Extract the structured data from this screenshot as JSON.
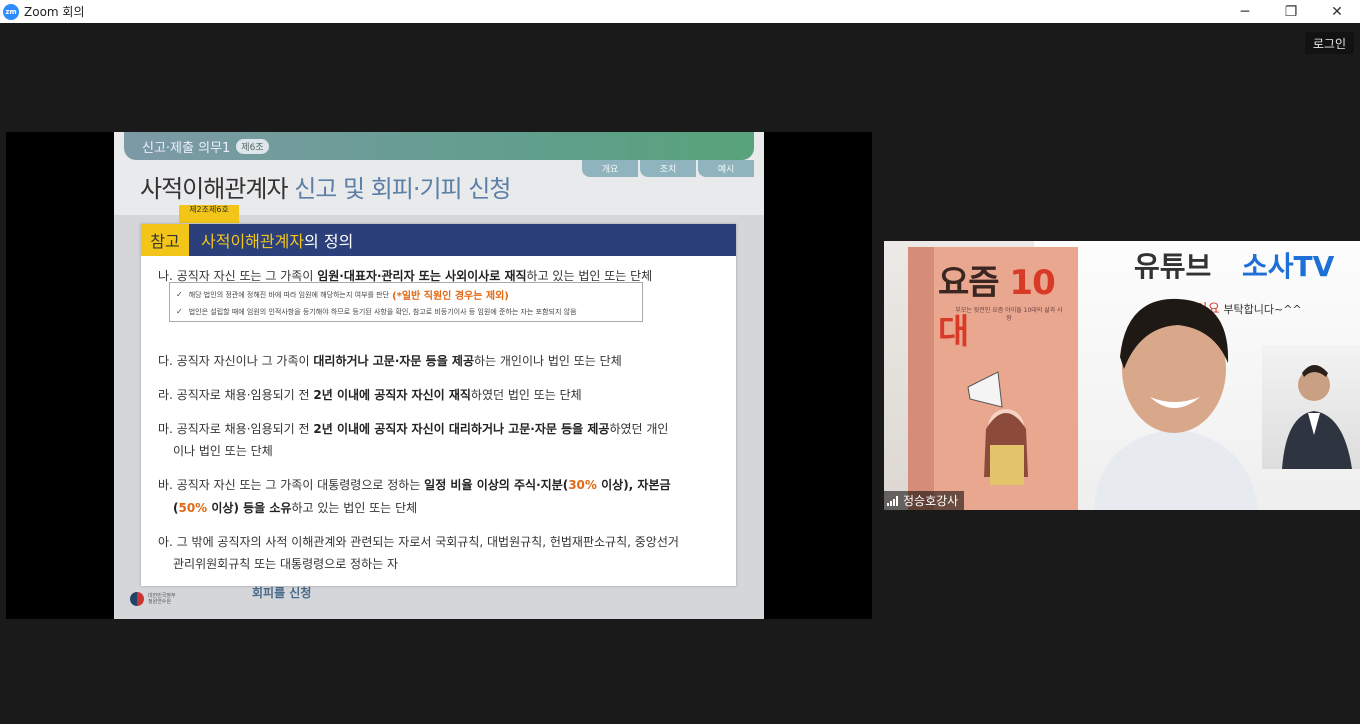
{
  "window": {
    "app_logo": "zm",
    "title": "Zoom 회의"
  },
  "controls": {
    "minimize": "─",
    "maximize": "❐",
    "close": "✕"
  },
  "toolbar": {
    "login_label": "로그인"
  },
  "slide": {
    "banner_label": "신고·제출 의무1",
    "banner_article": "제6조",
    "tabs": [
      "개요",
      "조치",
      "예시"
    ],
    "title_main": "사적이해관계자",
    "title_sub": " 신고 및 회피·기피 신청",
    "article_tag": "제2조제6호",
    "ref_badge": "참고",
    "ref_heading_highlight": "사적이해관계자",
    "ref_heading_rest": "의 정의",
    "na_pre": "나. 공직자 자신 또는 그 가족이 ",
    "na_bold": "임원·대표자·관리자 또는 사외이사로 재직",
    "na_post": "하고 있는 법인 또는 단체",
    "note1": "해당 법인의 정관에 정해진 바에 따라 임원에 해당하는지 여부를 판단",
    "note1_red": "(*일반 직원인 경우는 제외)",
    "note2": "법인은 설립할 때에 임원의 인적사항을 등기해야 하므로 등기된 사항을 확인, 참고로 비등기이사 등 임원에 준하는 자는 포함되지 않음",
    "check_mark": "✓",
    "da_pre": "다. 공직자 자신이나 그 가족이 ",
    "da_bold": "대리하거나 고문·자문 등을 제공",
    "da_post": "하는 개인이나 법인 또는 단체",
    "ra_pre": "라. 공직자로 채용·임용되기 전 ",
    "ra_bold": "2년 이내에 공직자 자신이 재직",
    "ra_post": "하였던 법인 또는 단체",
    "ma_pre": "마. 공직자로 채용·임용되기 전 ",
    "ma_bold": "2년 이내에 공직자 자신이 대리하거나 고문·자문 등을 제공",
    "ma_post": "하였던 개인",
    "ma_line2": "이나 법인 또는 단체",
    "ba_pre": "바. 공직자 자신 또는 그 가족이 대통령령으로 정하는 ",
    "ba_bold1": "일정 비율 이상의 주식·지분(",
    "ba_pct1": "30%",
    "ba_bold2": " 이상), 자본금",
    "ba_l2_open": "(",
    "ba_pct2": "50%",
    "ba_l2_bold": " 이상) 등을 소유",
    "ba_l2_post": "하고 있는 법인 또는 단체",
    "a_line1": "아. 그 밖에 공직자의 사적 이해관계와 관련되는 자로서 국회규칙, 대법원규칙, 헌법재판소규칙, 중앙선거",
    "a_line2": "관리위원회규칙 또는 대통령령으로 정하는 자",
    "footer_text": "회피를 신청",
    "org_line1": "대한민국정부",
    "org_line2": "정원연수원"
  },
  "video": {
    "book_title": "요즘",
    "book_title_num": "10대",
    "book_caption": "부모는 뒷전인 요즘 아이들 10대의 삶과 사랑",
    "yt_label": "유튜브",
    "tv_label": "소사TV",
    "like_label": "좋아요",
    "like_suffix": " 부탁합니다~^^",
    "participant_name": "정승호강사"
  },
  "colors": {
    "accent": "#2d8cff",
    "slide_header": "#2b3f7a",
    "badge": "#f2c518",
    "highlight": "#e06a16"
  }
}
